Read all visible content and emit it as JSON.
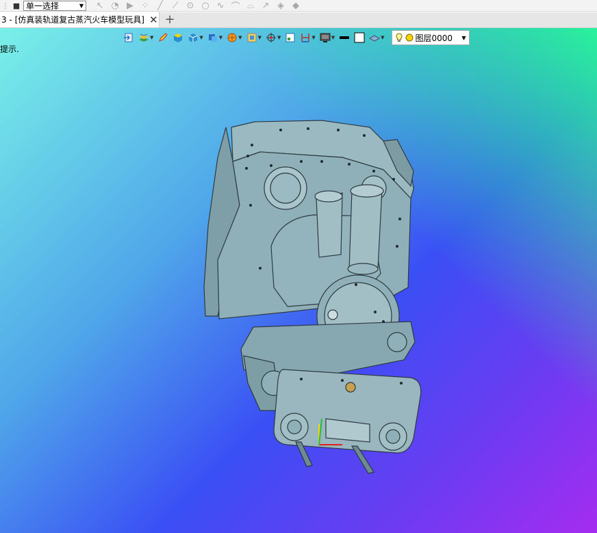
{
  "toolbar": {
    "selection_mode": "单一选择",
    "icons": [
      "stop-square-icon",
      "cursor-icon",
      "lasso-icon",
      "point-icon",
      "line-icon",
      "circle-icon",
      "curve-icon"
    ]
  },
  "tabs": {
    "document_title": "3 - [仿真装轨道复古蒸汽火车模型玩具]",
    "add_label": "+"
  },
  "viewport": {
    "hint": "提示.",
    "layer_name": "图层0000"
  },
  "colors": {
    "model_fill": "#8fb0b8",
    "model_stroke": "#2d3a40",
    "accent_yellow": "#f5d400"
  }
}
